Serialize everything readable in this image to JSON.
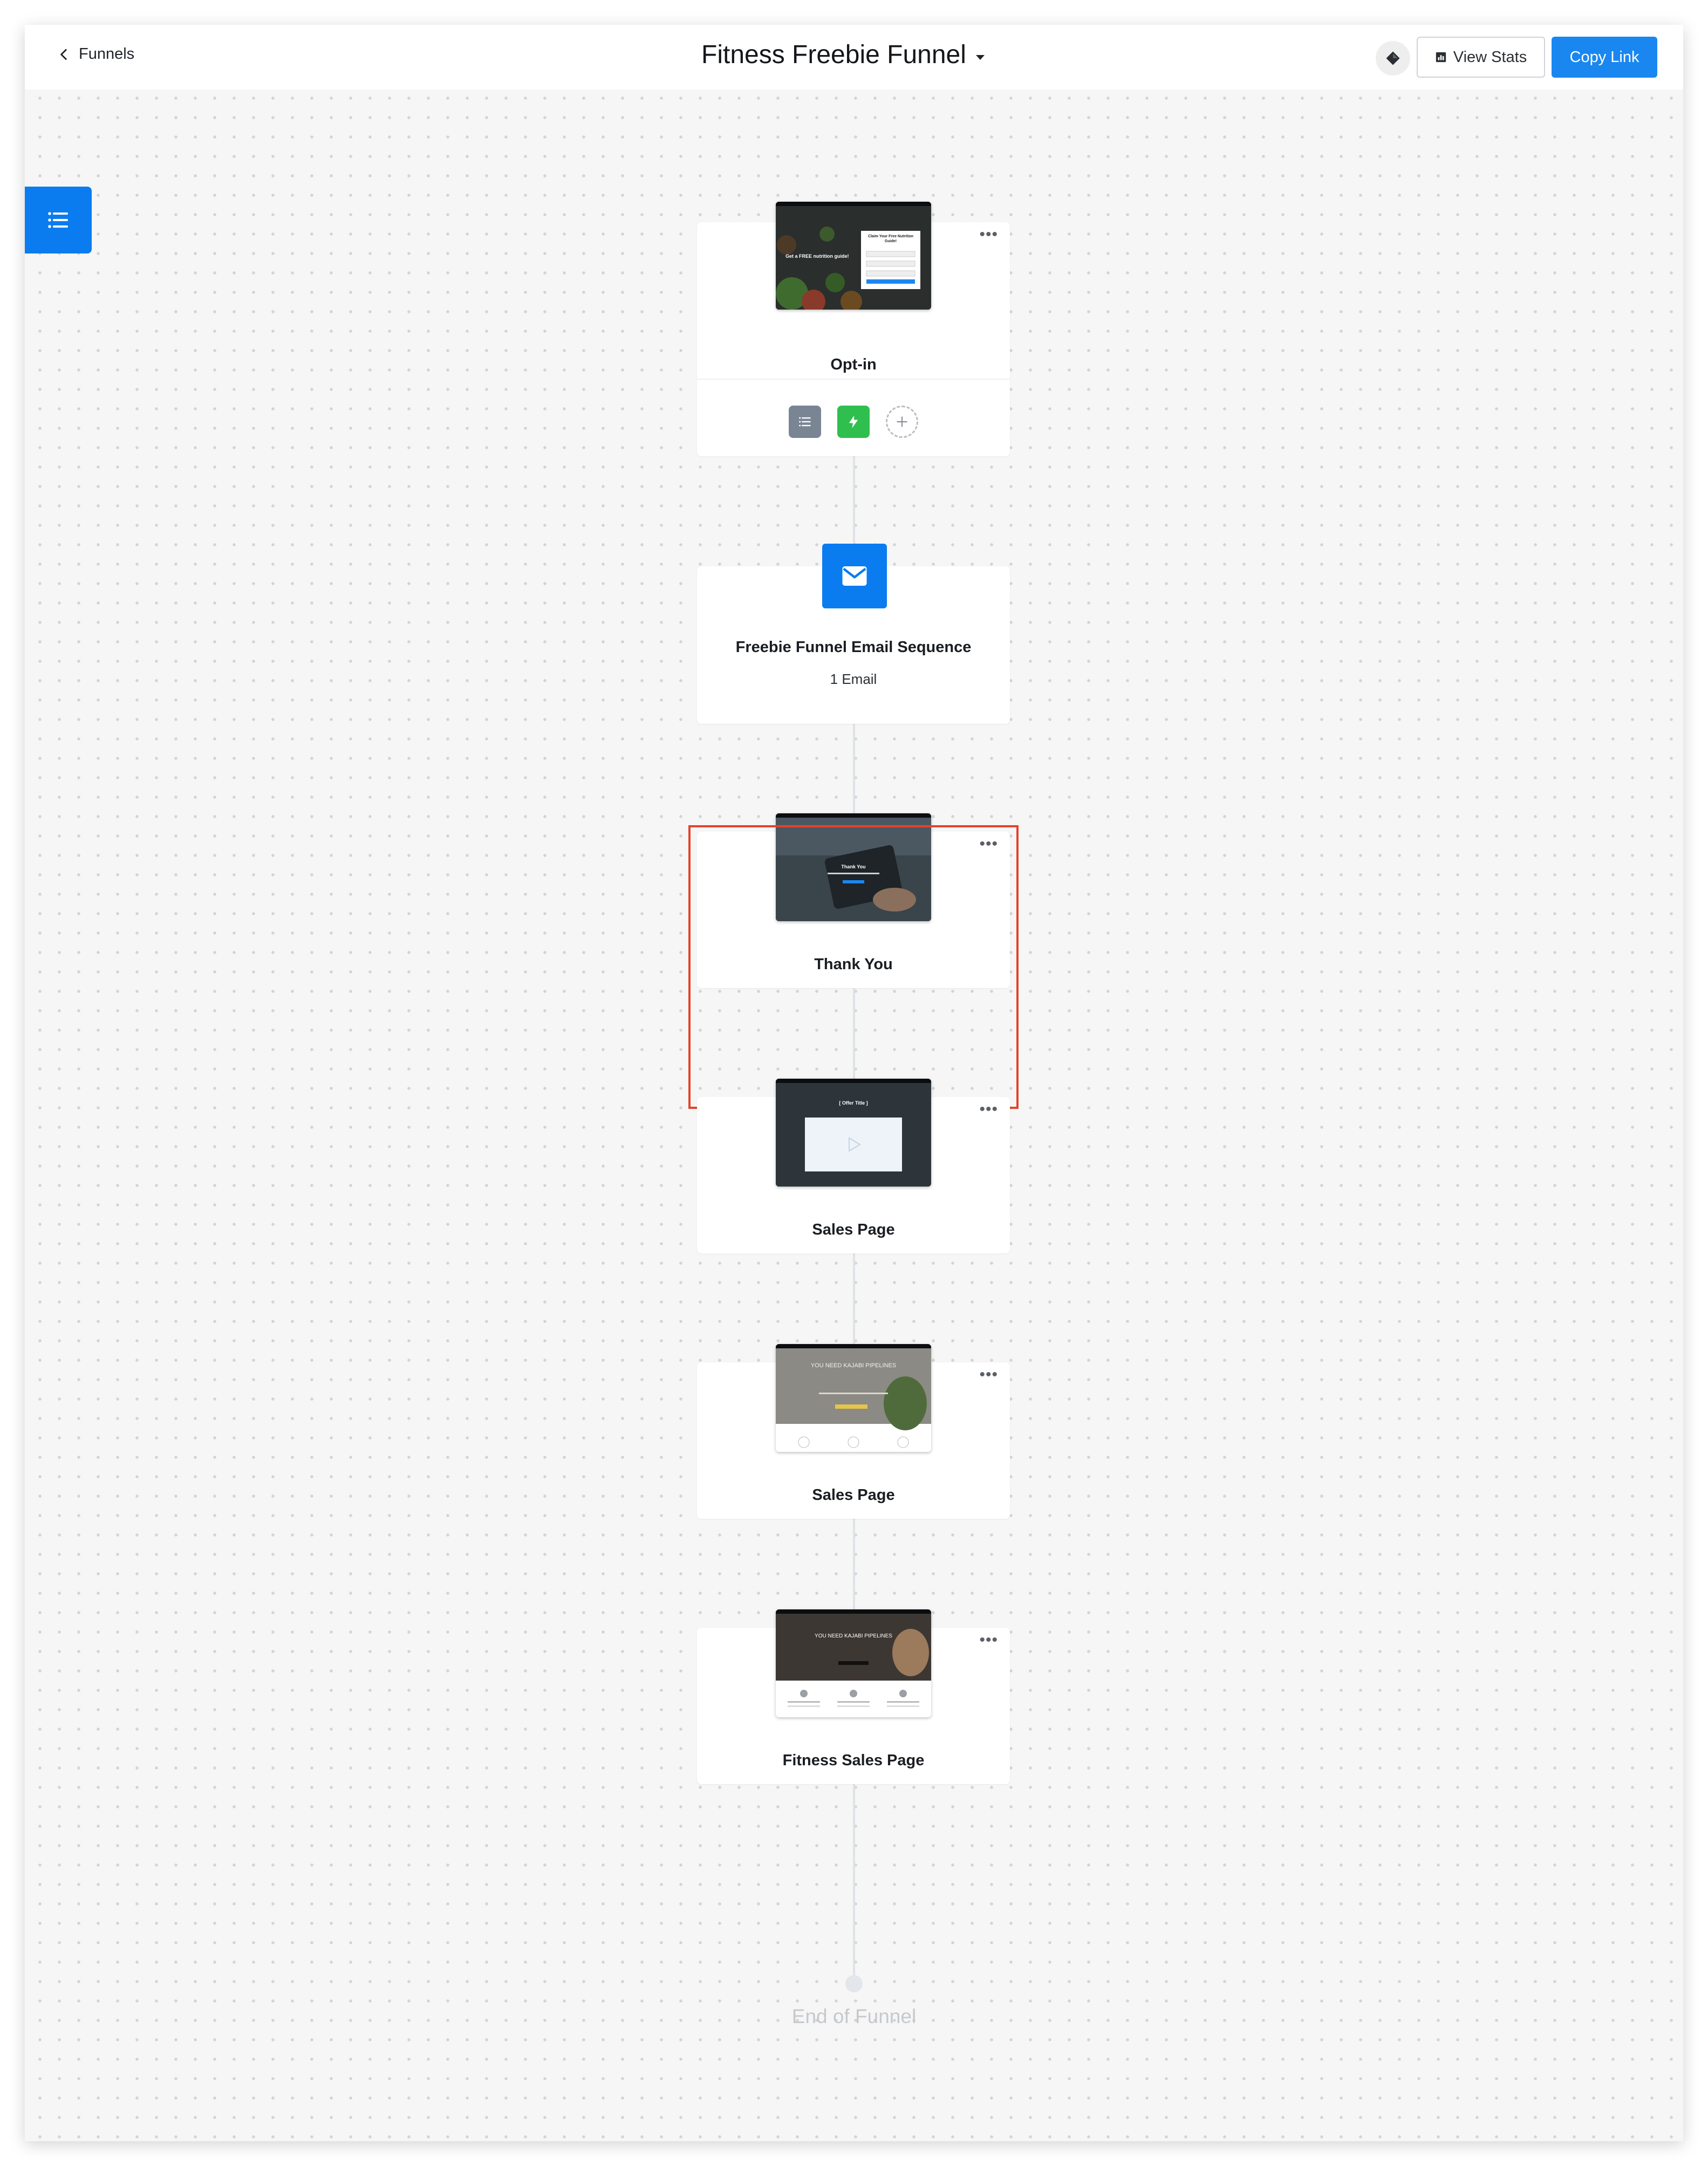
{
  "header": {
    "back_label": "Funnels",
    "title": "Fitness Freebie Funnel",
    "view_stats_label": "View Stats",
    "copy_link_label": "Copy Link"
  },
  "steps": [
    {
      "name": "Opt-in",
      "type": "page"
    },
    {
      "name": "Freebie Funnel Email Sequence",
      "type": "email",
      "subtitle": "1 Email"
    },
    {
      "name": "Thank You",
      "type": "page"
    },
    {
      "name": "Sales Page",
      "type": "page"
    },
    {
      "name": "Sales Page",
      "type": "page"
    },
    {
      "name": "Fitness Sales Page",
      "type": "page"
    }
  ],
  "thumbnails": {
    "optin": {
      "headline": "Get a FREE nutrition guide!",
      "form_title": "Claim Your Free Nutrition Guide!"
    },
    "thankyou": {
      "headline": "Thank You"
    },
    "sales1": {
      "headline": "[ Offer Title ]"
    },
    "sales2": {
      "headline": "YOU NEED KAJABI PIPELINES"
    },
    "sales3": {
      "headline": "YOU NEED KAJABI PIPELINES"
    }
  },
  "icons": {
    "back": "chevron-left-icon",
    "title_caret": "caret-down-icon",
    "diamond": "diamond-icon",
    "stats": "bar-chart-icon",
    "sidebar": "list-icon",
    "email": "envelope-icon",
    "more": "more-horizontal-icon",
    "list_tool": "list-icon",
    "bolt_tool": "lightning-bolt-icon",
    "add_tool": "plus-icon"
  },
  "colors": {
    "primary": "#1a87f0",
    "sidebar_toggle": "#0a7cf0",
    "bolt_tool": "#2fbf4f",
    "list_tool": "#7a8594",
    "highlight": "#e4432a"
  },
  "end_label": "End of Funnel"
}
